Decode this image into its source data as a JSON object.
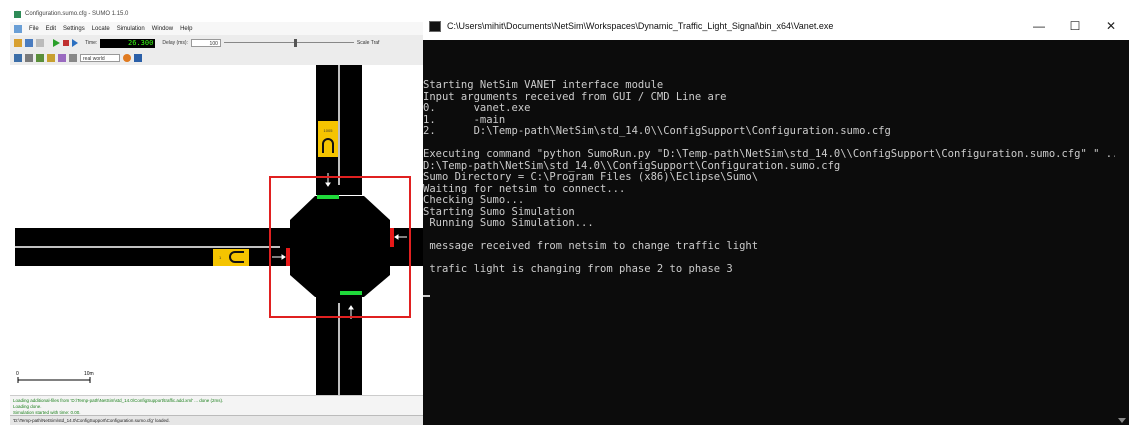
{
  "sumo": {
    "title": "Configuration.sumo.cfg - SUMO 1.15.0",
    "menu": [
      "File",
      "Edit",
      "Settings",
      "Locate",
      "Simulation",
      "Window",
      "Help"
    ],
    "time_label": "Time:",
    "time_value": "26.300",
    "delay_label": "Delay (ms):",
    "delay_value": "100",
    "scale_label": "Scale Traf",
    "scheme_value": "real world",
    "scale_bar_start": "0",
    "scale_bar_end": "10m",
    "sign_top": "1005",
    "sign_left": "1",
    "status_lines": [
      "Loading additional-files from 'D:\\Temp-path\\NetSim\\std_14.0\\ConfigSupport\\traffic.add.xml' ... done (2ms).",
      "Loading done.",
      "Simulation started with time: 0.00."
    ],
    "statusbar_text": "'D:\\Temp-path\\NetSim\\std_14.0\\ConfigSupport\\Configuration.sumo.cfg' loaded."
  },
  "console": {
    "title": "C:\\Users\\mihit\\Documents\\NetSim\\Workspaces\\Dynamic_Traffic_Light_Signal\\bin_x64\\Vanet.exe",
    "controls": {
      "minimize": "—",
      "maximize": "☐",
      "close": "✕"
    },
    "lines": [
      "Starting NetSim VANET interface module",
      "Input arguments received from GUI / CMD Line are",
      "0.      vanet.exe",
      "1.      -main",
      "2.      D:\\Temp-path\\NetSim\\std_14.0\\\\ConfigSupport\\Configuration.sumo.cfg",
      "",
      "Executing command \"python SumoRun.py \"D:\\Temp-path\\NetSim\\std_14.0\\\\ConfigSupport\\Configuration.sumo.cfg\" \" ...",
      "D:\\Temp-path\\NetSim\\std_14.0\\\\ConfigSupport\\Configuration.sumo.cfg",
      "Sumo Directory = C:\\Program Files (x86)\\Eclipse\\Sumo\\",
      "Waiting for netsim to connect...",
      "Checking Sumo...",
      "Starting Sumo Simulation",
      " Running Sumo Simulation...",
      "",
      " message received from netsim to change traffic light",
      "",
      " trafic light is changing from phase 2 to phase 3",
      ""
    ]
  },
  "colors": {
    "road": "#000000",
    "lane_marking": "#ffffff",
    "signal_green": "#1fd93a",
    "signal_red": "#e81818",
    "highlight_box": "#e02020",
    "sign_yellow": "#f5c400",
    "console_bg": "#0c0c0c",
    "console_text": "#cccccc"
  }
}
